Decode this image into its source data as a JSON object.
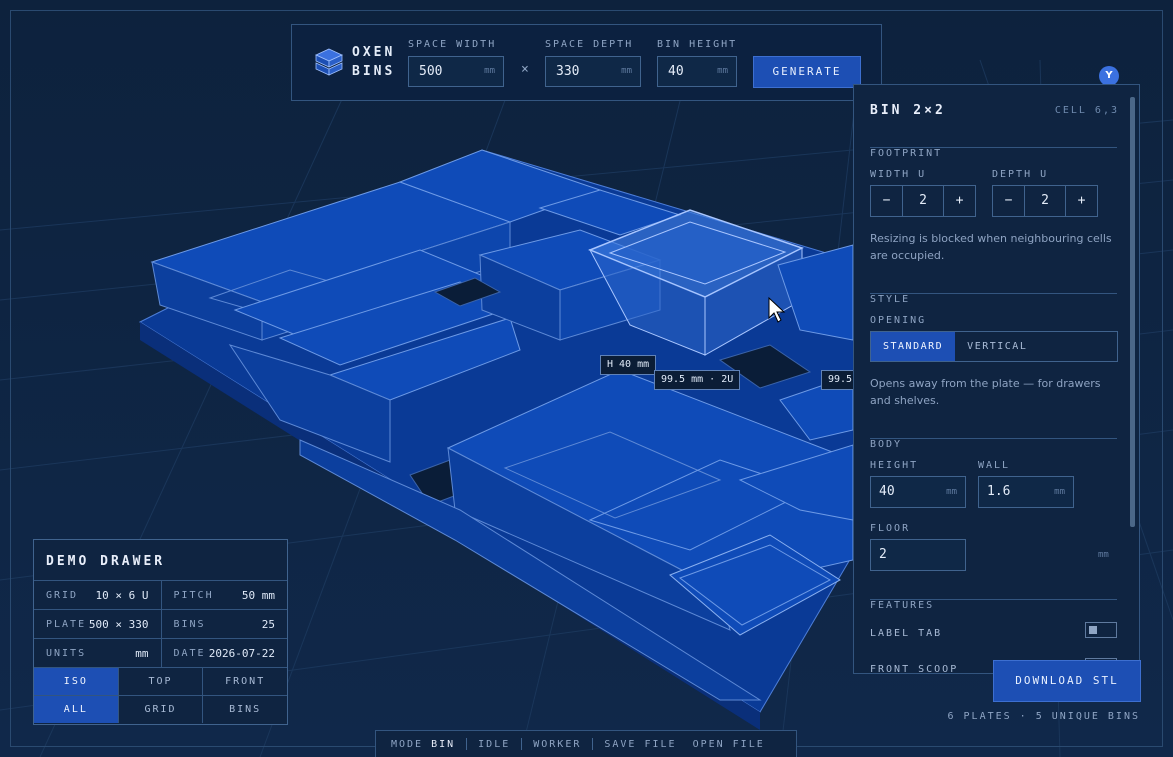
{
  "app": {
    "logo_line1": "OXEN",
    "logo_line2": "BINS"
  },
  "topbar": {
    "space_width_label": "SPACE WIDTH",
    "space_width_value": "500",
    "space_depth_label": "SPACE DEPTH",
    "space_depth_value": "330",
    "bin_height_label": "BIN HEIGHT",
    "bin_height_value": "40",
    "unit": "mm",
    "times": "×",
    "generate_label": "GENERATE"
  },
  "viewport": {
    "tag_height": "H 40 mm",
    "tag_width": "99.5 mm · 2U",
    "tag_side": "99.5",
    "axis_y": "Y"
  },
  "panel": {
    "title": "BIN 2×2",
    "cell": "CELL 6,3",
    "footprint_label": "FOOTPRINT",
    "width_u_label": "WIDTH U",
    "width_u_value": "2",
    "depth_u_label": "DEPTH U",
    "depth_u_value": "2",
    "minus": "−",
    "plus": "+",
    "resize_note": "Resizing is blocked when neighbouring cells are occupied.",
    "style_label": "STYLE",
    "opening_label": "OPENING",
    "opening_options": [
      "STANDARD",
      "VERTICAL"
    ],
    "opening_selected": "STANDARD",
    "opening_note": "Opens away from the plate — for drawers and shelves.",
    "body_label": "BODY",
    "height_label": "HEIGHT",
    "height_value": "40",
    "wall_label": "WALL",
    "wall_value": "1.6",
    "floor_label": "FLOOR",
    "floor_value": "2",
    "unit": "mm",
    "features_label": "FEATURES",
    "feature_label_tab": "LABEL TAB",
    "feature_front_scoop": "FRONT SCOOP",
    "label_tab_on": false,
    "front_scoop_on": false
  },
  "download": {
    "label": "DOWNLOAD STL",
    "summary": "6 PLATES · 5 UNIQUE BINS"
  },
  "demo": {
    "title": "DEMO DRAWER",
    "grid_key": "GRID",
    "grid_val": "10 × 6 U",
    "pitch_key": "PITCH",
    "pitch_val": "50 mm",
    "plate_key": "PLATE",
    "plate_val": "500 × 330",
    "bins_key": "BINS",
    "bins_val": "25",
    "units_key": "UNITS",
    "units_val": "mm",
    "date_key": "DATE",
    "date_val": "2026-07-22",
    "views": [
      "ISO",
      "TOP",
      "FRONT"
    ],
    "view_selected": "ISO",
    "filters": [
      "ALL",
      "GRID",
      "BINS"
    ],
    "filter_selected": "ALL"
  },
  "status": {
    "mode_label": "MODE",
    "mode_value": "BIN",
    "state": "IDLE",
    "worker": "WORKER",
    "save_file": "SAVE FILE",
    "open_file": "OPEN FILE"
  },
  "colors": {
    "background": "#0e2440",
    "bin_blue": "#0f4bb8",
    "accent": "#1d4fb4",
    "selected_bin": "#3f7de0"
  }
}
